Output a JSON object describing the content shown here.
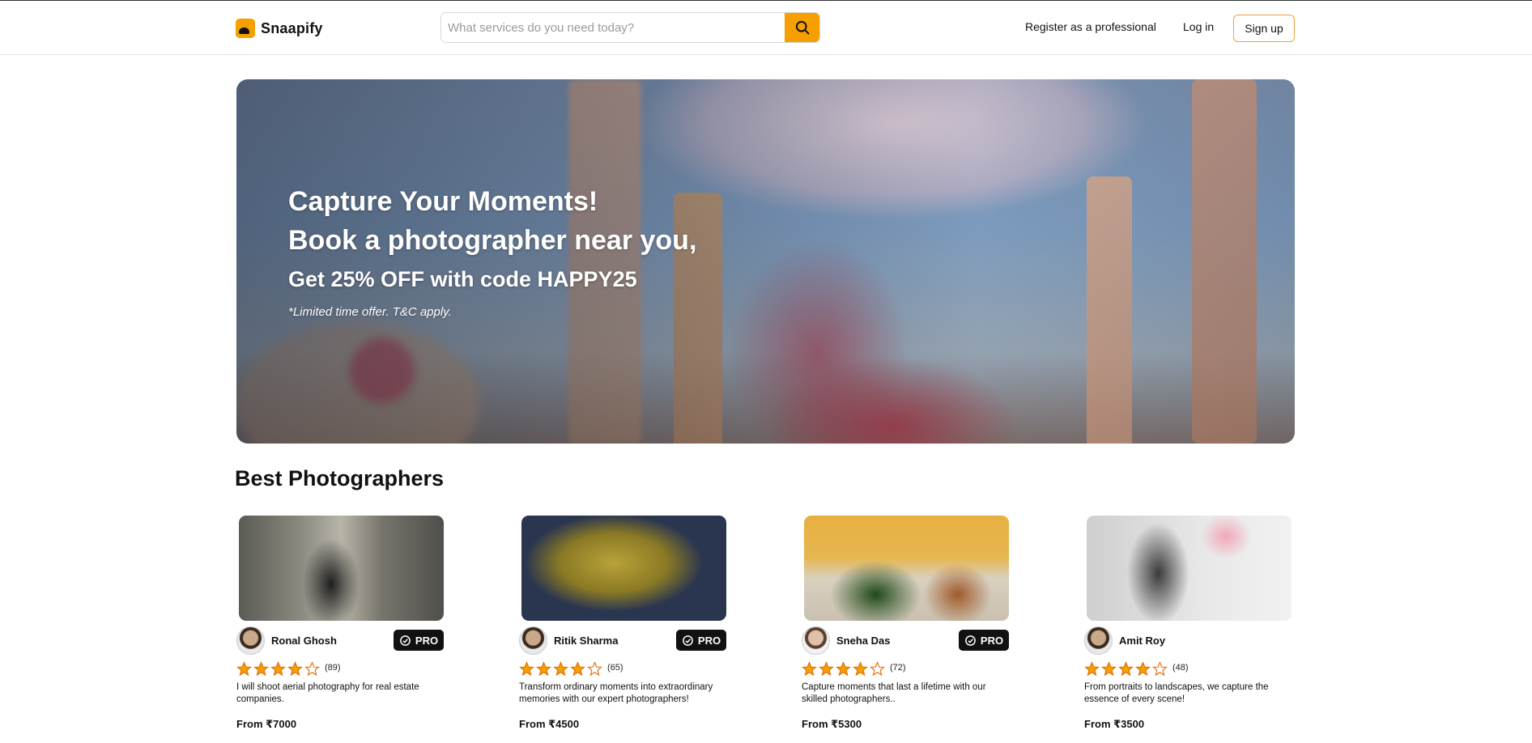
{
  "header": {
    "brand": "Snaapify",
    "search_placeholder": "What services do you need today?",
    "register_label": "Register as a professional",
    "login_label": "Log in",
    "signup_label": "Sign up",
    "accent_color": "#f5a000"
  },
  "hero": {
    "line1": "Capture Your Moments!",
    "line2": "Book a photographer near you,",
    "line3": "Get 25% OFF with code HAPPY25",
    "note": "*Limited time offer. T&C apply."
  },
  "section": {
    "title": "Best Photographers"
  },
  "photographers": [
    {
      "name": "Ronal Ghosh",
      "pro": true,
      "pro_label": "PRO",
      "rating": 4,
      "reviews": "(89)",
      "description": "I will shoot aerial photography for real estate companies.",
      "price": "From ₹7000",
      "icon": "camera-man-photo"
    },
    {
      "name": "Ritik Sharma",
      "pro": true,
      "pro_label": "PRO",
      "rating": 4,
      "reviews": "(65)",
      "description": "Transform ordinary moments into extraordinary memories with our expert photographers!",
      "price": "From ₹4500",
      "icon": "curry-bowl-photo"
    },
    {
      "name": "Sneha Das",
      "pro": true,
      "pro_label": "PRO",
      "rating": 4,
      "reviews": "(72)",
      "description": "Capture moments that last a lifetime with our skilled photographers..",
      "price": "From ₹5300",
      "icon": "food-plate-photo"
    },
    {
      "name": "Amit Roy",
      "pro": false,
      "rating": 4,
      "reviews": "(48)",
      "description": "From portraits to landscapes, we capture the essence of every scene!",
      "price": "From ₹3500",
      "icon": "figure-sculpture-photo"
    }
  ]
}
